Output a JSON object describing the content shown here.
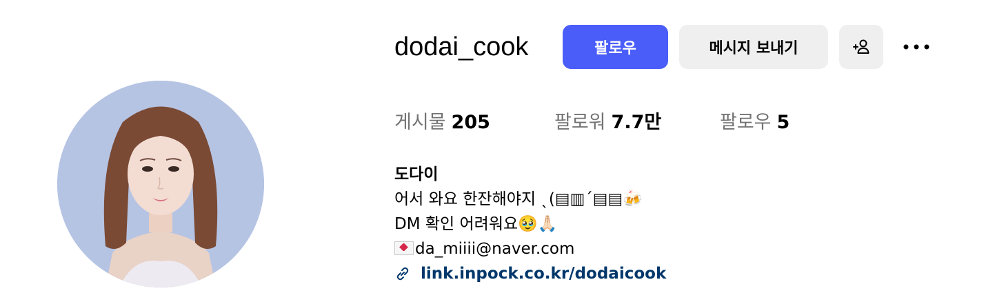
{
  "profile": {
    "username": "dodai_cook",
    "name": "도다이",
    "bio_lines": [
      "어서 와요 한잔해야지 ˎ(▤▥ˊ▤▤🍻",
      "DM 확인 어려워요🥹🙏🏻",
      "da_miiii@naver.com"
    ],
    "link": "link.inpock.co.kr/dodaicook"
  },
  "actions": {
    "follow_label": "팔로우",
    "message_label": "메시지 보내기",
    "adduser_icon": "person-add-icon",
    "more_icon": "more-horizontal-icon"
  },
  "stats": {
    "posts_label": "게시물",
    "posts_value": "205",
    "followers_label": "팔로워",
    "followers_value": "7.7만",
    "following_label": "팔로우",
    "following_value": "5"
  },
  "icons": {
    "email": "love-letter-icon",
    "link": "link-icon"
  },
  "colors": {
    "accent": "#4a5df9",
    "secondary_button": "#efefef",
    "muted_text": "#737373",
    "link_text": "#00376b"
  }
}
